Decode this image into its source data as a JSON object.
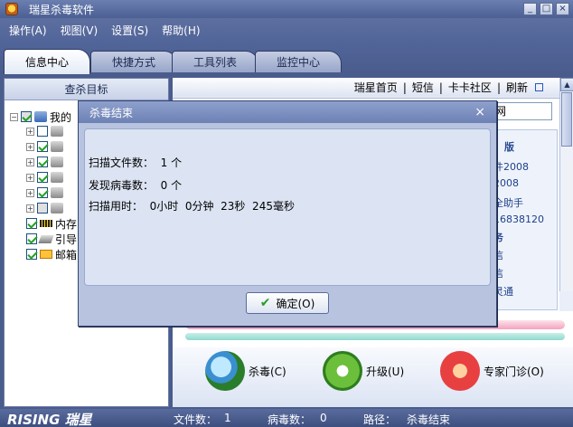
{
  "window": {
    "title": "瑞星杀毒软件",
    "controls": [
      "_",
      "□",
      "×"
    ]
  },
  "menu": [
    "操作(A)",
    "视图(V)",
    "设置(S)",
    "帮助(H)"
  ],
  "tabs": [
    "信息中心",
    "快捷方式",
    "工具列表",
    "监控中心"
  ],
  "left": {
    "header": "查杀目标",
    "tree": {
      "root": "我的",
      "memory": "内存",
      "boot": "引导",
      "mail": "邮箱"
    }
  },
  "links": {
    "home": "瑞星首页",
    "sms": "短信",
    "community": "卡卡社区",
    "refresh": "刷新"
  },
  "web": {
    "input": "网",
    "lines": [
      "版",
      "件2008",
      "2008",
      "全助手",
      "16838120",
      "务",
      "信",
      "信",
      "灵通"
    ]
  },
  "actions": {
    "kill": "杀毒(C)",
    "upgrade": "升级(U)",
    "expert": "专家门诊(O)"
  },
  "status": {
    "brand": "RISING 瑞星",
    "files_label": "文件数：",
    "files_value": "1",
    "virus_label": "病毒数：",
    "virus_value": "0",
    "path_label": "路径：",
    "path_value": "杀毒结束"
  },
  "dialog": {
    "title": "杀毒结束",
    "close": "×",
    "lines": [
      "扫描文件数：  1 个",
      "发现病毒数：  0 个",
      "扫描用时：  0小时  0分钟  23秒  245毫秒"
    ],
    "ok": "确定(O)"
  }
}
